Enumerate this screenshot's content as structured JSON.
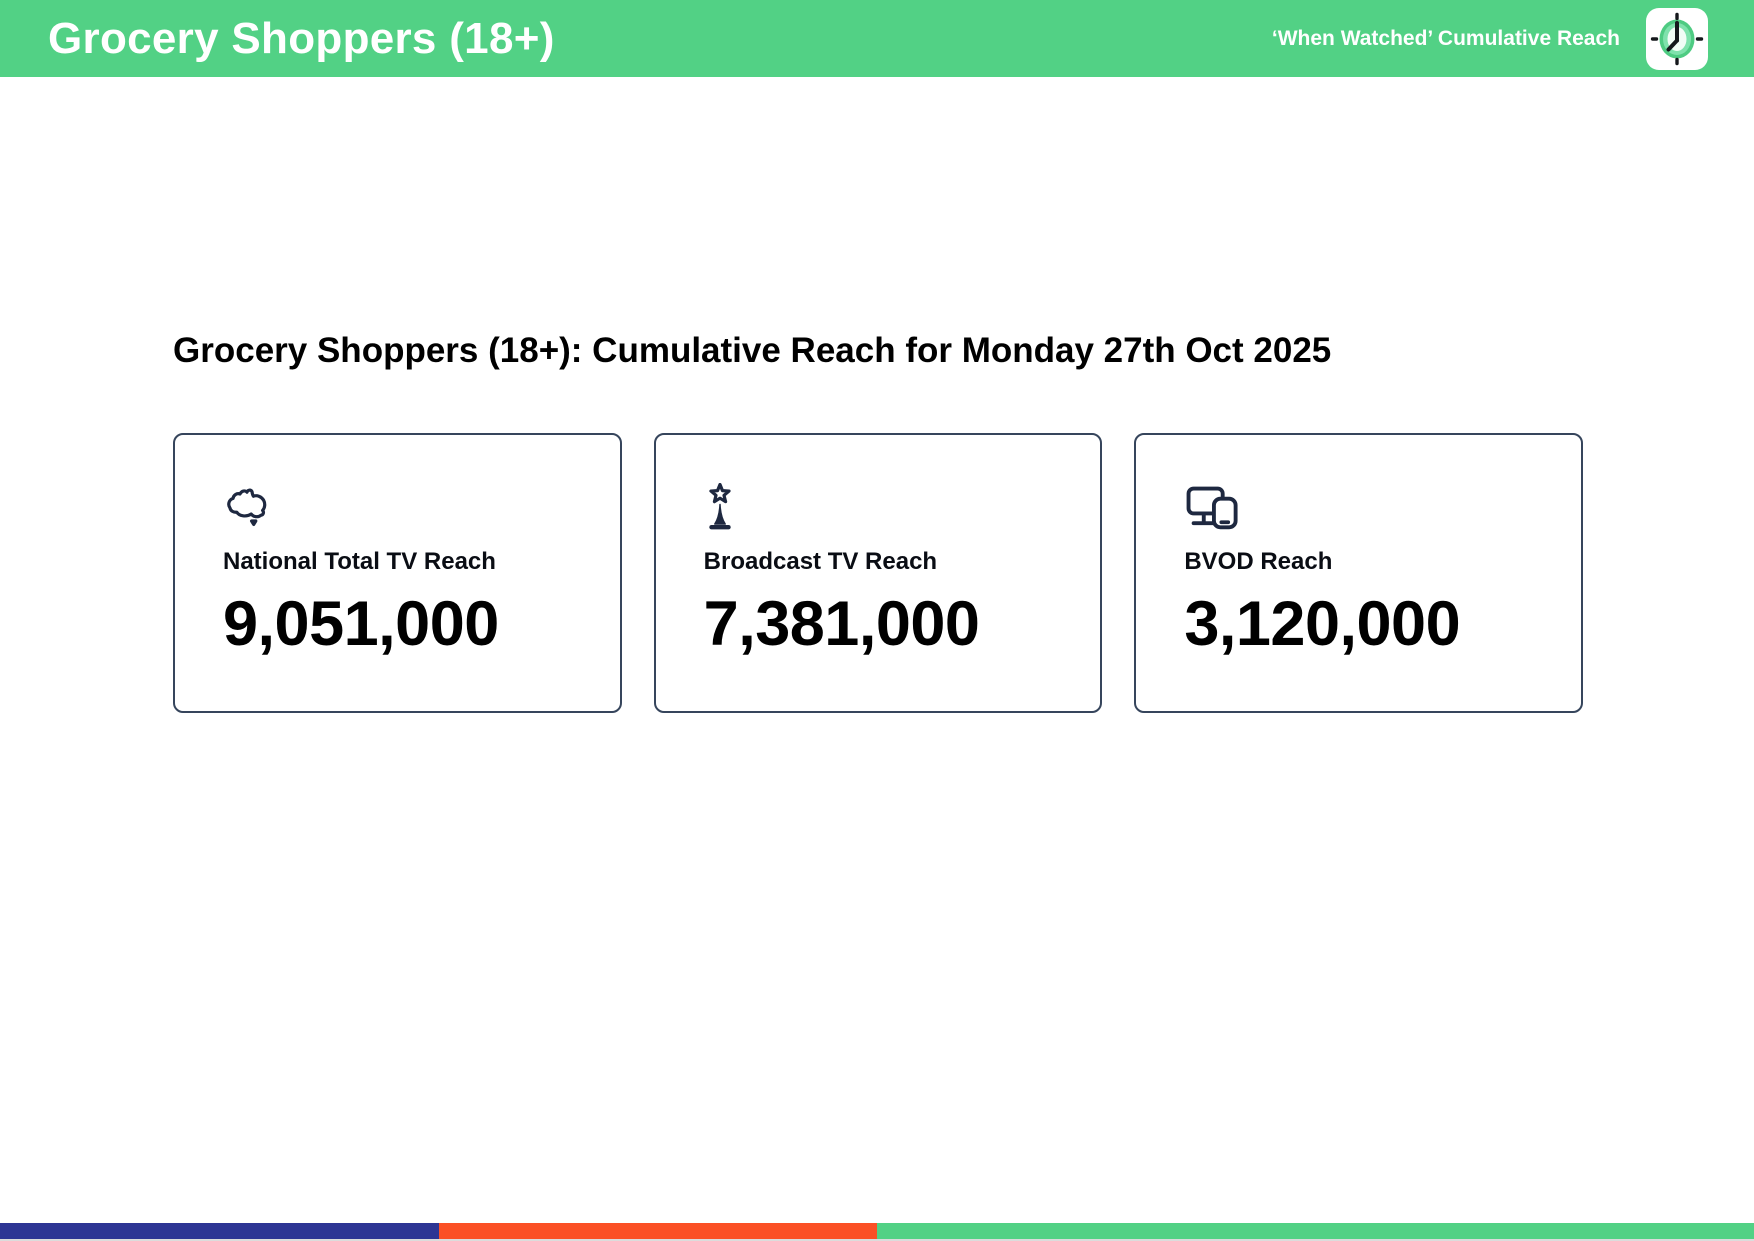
{
  "header": {
    "title": "Grocery Shoppers (18+)",
    "tagline": "‘When Watched’ Cumulative Reach",
    "logo_icon": "clock-logo-icon",
    "bg_color": "#52d185"
  },
  "main": {
    "heading": "Grocery Shoppers (18+): Cumulative Reach for Monday 27th Oct 2025",
    "cards": [
      {
        "icon": "australia-map-icon",
        "label": "National Total TV Reach",
        "value": "9,051,000"
      },
      {
        "icon": "broadcast-tower-icon",
        "label": "Broadcast TV Reach",
        "value": "7,381,000"
      },
      {
        "icon": "screens-devices-icon",
        "label": "BVOD Reach",
        "value": "3,120,000"
      }
    ]
  },
  "footer": {
    "bar_segments": [
      {
        "name": "navy",
        "color": "#2d3594",
        "width_pct": 25
      },
      {
        "name": "orange",
        "color": "#fb5025",
        "width_pct": 25
      },
      {
        "name": "green",
        "color": "#52d185",
        "width_pct": 50
      }
    ]
  },
  "theme": {
    "accent_green": "#52d185",
    "card_border": "#36455c",
    "icon_navy": "#1e2840",
    "text_black": "#0a0d14"
  }
}
